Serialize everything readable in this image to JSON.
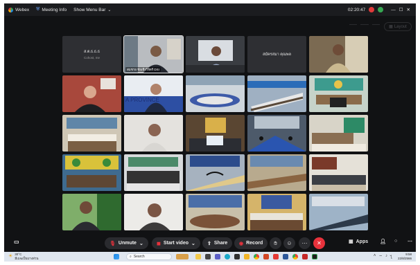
{
  "topbar": {
    "app_name": "Webex",
    "meeting_info": "Meeting Info",
    "show_menu_bar": "Show Menu Bar",
    "timer": "02:20:47",
    "colors": {
      "record": "#e03a3a",
      "webex_green": "#35a852"
    }
  },
  "layout_button": {
    "label": "Layout"
  },
  "participants": [
    {
      "name": "ส.ต.ธ.ธ.ธ",
      "subtitle": "Cohost, me",
      "kind": "namecard"
    },
    {
      "name": "สมชาย ชัยเชิงวิจิตร์ DSI",
      "kind": "video",
      "active": true
    },
    {
      "name": "",
      "kind": "video"
    },
    {
      "name": "สมัครสมา คุณพล",
      "kind": "namecard"
    },
    {
      "name": "",
      "kind": "video"
    }
  ],
  "controls": {
    "unmute": "Unmute",
    "start_video": "Start video",
    "share": "Share",
    "record": "Record",
    "apps": "Apps",
    "colors": {
      "leave": "#e8323c",
      "mute_red": "#e8323c",
      "record_red": "#e8323c"
    }
  },
  "taskbar": {
    "weather_temp": "30°C",
    "weather_desc": "มีเมฆเป็นบางส่วน",
    "search_placeholder": "Search",
    "time": "9:58",
    "date": "22/8/2566"
  }
}
